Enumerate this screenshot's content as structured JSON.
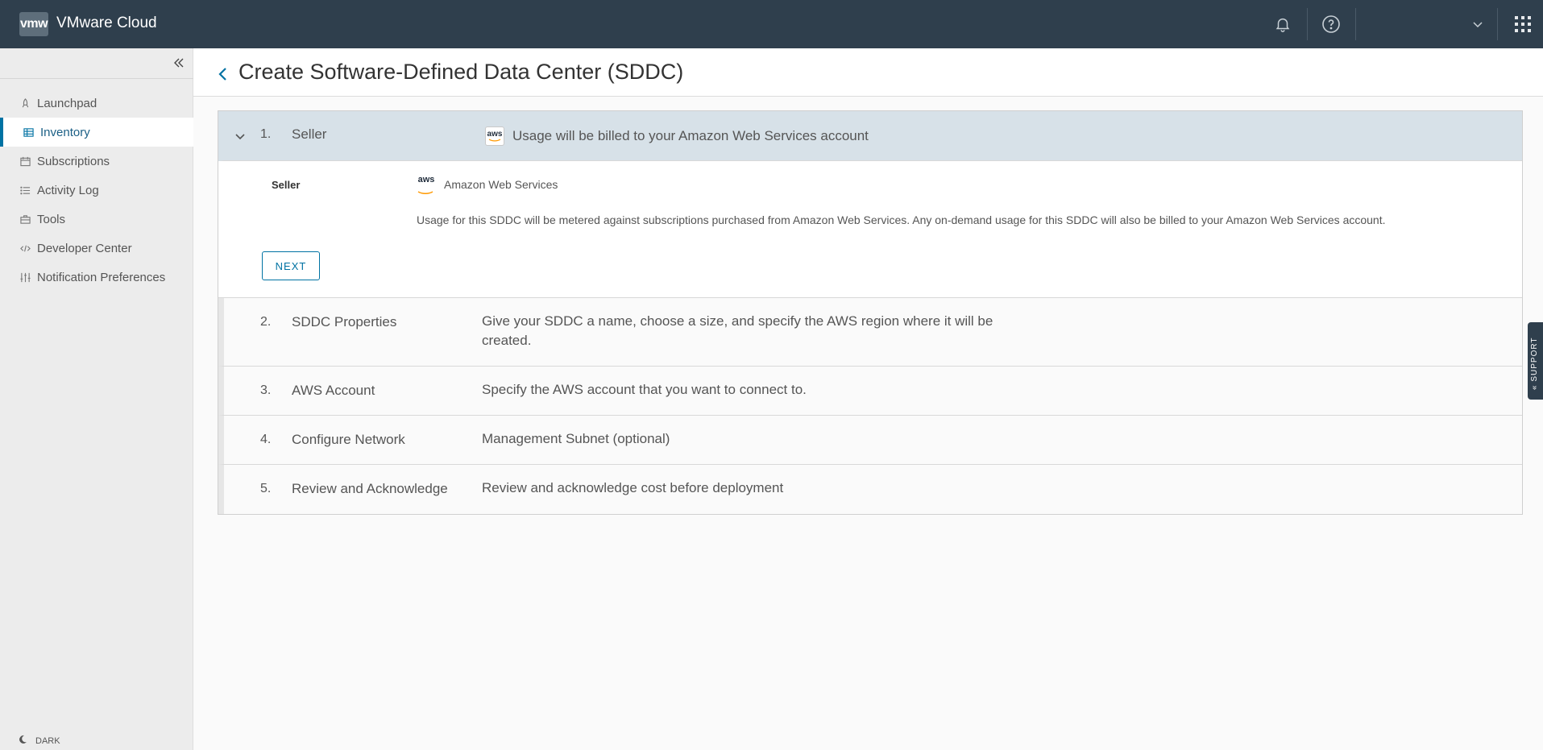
{
  "header": {
    "logo_text": "vmw",
    "app_title": "VMware Cloud"
  },
  "sidebar": {
    "items": [
      {
        "label": "Launchpad",
        "icon": "rocket-icon"
      },
      {
        "label": "Inventory",
        "icon": "grid-icon",
        "active": true
      },
      {
        "label": "Subscriptions",
        "icon": "calendar-icon"
      },
      {
        "label": "Activity Log",
        "icon": "list-icon"
      },
      {
        "label": "Tools",
        "icon": "toolbox-icon"
      },
      {
        "label": "Developer Center",
        "icon": "code-icon"
      },
      {
        "label": "Notification Preferences",
        "icon": "sliders-icon"
      }
    ],
    "dark_label": "DARK"
  },
  "page": {
    "title": "Create Software-Defined Data Center (SDDC)"
  },
  "wizard": {
    "steps": [
      {
        "num": "1.",
        "name": "Seller",
        "desc": "Usage will be billed to your Amazon Web Services account"
      },
      {
        "num": "2.",
        "name": "SDDC Properties",
        "desc_line1": "Give your SDDC a name, choose a size, and specify the AWS region where it will be",
        "desc_line2": "created."
      },
      {
        "num": "3.",
        "name": "AWS Account",
        "desc": "Specify the AWS account that you want to connect to."
      },
      {
        "num": "4.",
        "name": "Configure Network",
        "desc": "Management Subnet (optional)"
      },
      {
        "num": "5.",
        "name": "Review and Acknowledge",
        "desc": "Review and acknowledge cost before deployment"
      }
    ],
    "seller": {
      "label": "Seller",
      "value": "Amazon Web Services",
      "aws_logo_text": "aws",
      "note": "Usage for this SDDC will be metered against subscriptions purchased from Amazon Web Services. Any on-demand usage for this SDDC will also be billed to your Amazon Web Services account.",
      "next_label": "NEXT"
    }
  },
  "support": {
    "label": "SUPPORT"
  },
  "colors": {
    "header_bg": "#2f3f4d",
    "accent": "#0072a3",
    "active_step_bg": "#d7e1e8"
  }
}
